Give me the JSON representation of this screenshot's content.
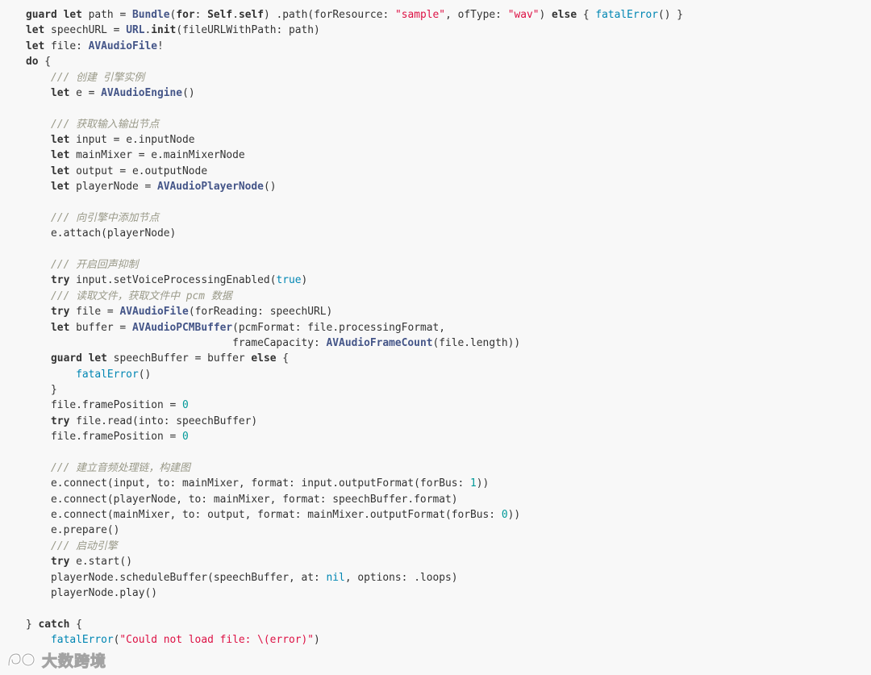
{
  "colors": {
    "background": "#f8f8f8",
    "plain": "#333333",
    "keyword": "#333333",
    "type": "#445588",
    "string": "#dd1144",
    "number": "#009999",
    "literal": "#0086b3",
    "comment": "#999988"
  },
  "code_lines": [
    [
      [
        "kw",
        "guard"
      ],
      [
        "pl",
        " "
      ],
      [
        "kw",
        "let"
      ],
      [
        "pl",
        " path = "
      ],
      [
        "ty",
        "Bundle"
      ],
      [
        "pl",
        "("
      ],
      [
        "kw",
        "for"
      ],
      [
        "pl",
        ": "
      ],
      [
        "kw",
        "Self"
      ],
      [
        "pl",
        "."
      ],
      [
        "kw",
        "self"
      ],
      [
        "pl",
        ") .path(forResource: "
      ],
      [
        "str",
        "\"sample\""
      ],
      [
        "pl",
        ", ofType: "
      ],
      [
        "str",
        "\"wav\""
      ],
      [
        "pl",
        ") "
      ],
      [
        "kw",
        "else"
      ],
      [
        "pl",
        " { "
      ],
      [
        "fn",
        "fatalError"
      ],
      [
        "pl",
        "() }"
      ]
    ],
    [
      [
        "kw",
        "let"
      ],
      [
        "pl",
        " speechURL = "
      ],
      [
        "ty",
        "URL"
      ],
      [
        "pl",
        "."
      ],
      [
        "kw",
        "init"
      ],
      [
        "pl",
        "(fileURLWithPath: path)"
      ]
    ],
    [
      [
        "kw",
        "let"
      ],
      [
        "pl",
        " file: "
      ],
      [
        "ty",
        "AVAudioFile"
      ],
      [
        "pl",
        "!"
      ]
    ],
    [
      [
        "kw",
        "do"
      ],
      [
        "pl",
        " {"
      ]
    ],
    [
      [
        "pl",
        "    "
      ],
      [
        "com",
        "/// 创建 引擎实例"
      ]
    ],
    [
      [
        "pl",
        "    "
      ],
      [
        "kw",
        "let"
      ],
      [
        "pl",
        " e = "
      ],
      [
        "ty",
        "AVAudioEngine"
      ],
      [
        "pl",
        "()"
      ]
    ],
    [
      [
        "pl",
        ""
      ]
    ],
    [
      [
        "pl",
        "    "
      ],
      [
        "com",
        "/// 获取输入输出节点"
      ]
    ],
    [
      [
        "pl",
        "    "
      ],
      [
        "kw",
        "let"
      ],
      [
        "pl",
        " input = e.inputNode"
      ]
    ],
    [
      [
        "pl",
        "    "
      ],
      [
        "kw",
        "let"
      ],
      [
        "pl",
        " mainMixer = e.mainMixerNode"
      ]
    ],
    [
      [
        "pl",
        "    "
      ],
      [
        "kw",
        "let"
      ],
      [
        "pl",
        " output = e.outputNode"
      ]
    ],
    [
      [
        "pl",
        "    "
      ],
      [
        "kw",
        "let"
      ],
      [
        "pl",
        " playerNode = "
      ],
      [
        "ty",
        "AVAudioPlayerNode"
      ],
      [
        "pl",
        "()"
      ]
    ],
    [
      [
        "pl",
        ""
      ]
    ],
    [
      [
        "pl",
        "    "
      ],
      [
        "com",
        "/// 向引擎中添加节点"
      ]
    ],
    [
      [
        "pl",
        "    e.attach(playerNode)"
      ]
    ],
    [
      [
        "pl",
        ""
      ]
    ],
    [
      [
        "pl",
        "    "
      ],
      [
        "com",
        "/// 开启回声抑制"
      ]
    ],
    [
      [
        "pl",
        "    "
      ],
      [
        "kw",
        "try"
      ],
      [
        "pl",
        " input.setVoiceProcessingEnabled("
      ],
      [
        "lit",
        "true"
      ],
      [
        "pl",
        ")"
      ]
    ],
    [
      [
        "pl",
        "    "
      ],
      [
        "com",
        "/// 读取文件，获取文件中 pcm 数据"
      ]
    ],
    [
      [
        "pl",
        "    "
      ],
      [
        "kw",
        "try"
      ],
      [
        "pl",
        " file = "
      ],
      [
        "ty",
        "AVAudioFile"
      ],
      [
        "pl",
        "(forReading: speechURL)"
      ]
    ],
    [
      [
        "pl",
        "    "
      ],
      [
        "kw",
        "let"
      ],
      [
        "pl",
        " buffer = "
      ],
      [
        "ty",
        "AVAudioPCMBuffer"
      ],
      [
        "pl",
        "(pcmFormat: file.processingFormat,"
      ]
    ],
    [
      [
        "pl",
        "                                 frameCapacity: "
      ],
      [
        "ty",
        "AVAudioFrameCount"
      ],
      [
        "pl",
        "(file.length))"
      ]
    ],
    [
      [
        "pl",
        "    "
      ],
      [
        "kw",
        "guard"
      ],
      [
        "pl",
        " "
      ],
      [
        "kw",
        "let"
      ],
      [
        "pl",
        " speechBuffer = buffer "
      ],
      [
        "kw",
        "else"
      ],
      [
        "pl",
        " {"
      ]
    ],
    [
      [
        "pl",
        "        "
      ],
      [
        "fn",
        "fatalError"
      ],
      [
        "pl",
        "()"
      ]
    ],
    [
      [
        "pl",
        "    }"
      ]
    ],
    [
      [
        "pl",
        "    file.framePosition = "
      ],
      [
        "num",
        "0"
      ]
    ],
    [
      [
        "pl",
        "    "
      ],
      [
        "kw",
        "try"
      ],
      [
        "pl",
        " file.read(into: speechBuffer)"
      ]
    ],
    [
      [
        "pl",
        "    file.framePosition = "
      ],
      [
        "num",
        "0"
      ]
    ],
    [
      [
        "pl",
        ""
      ]
    ],
    [
      [
        "pl",
        "    "
      ],
      [
        "com",
        "/// 建立音频处理链，构建图"
      ]
    ],
    [
      [
        "pl",
        "    e.connect(input, to: mainMixer, format: input.outputFormat(forBus: "
      ],
      [
        "num",
        "1"
      ],
      [
        "pl",
        "))"
      ]
    ],
    [
      [
        "pl",
        "    e.connect(playerNode, to: mainMixer, format: speechBuffer.format)"
      ]
    ],
    [
      [
        "pl",
        "    e.connect(mainMixer, to: output, format: mainMixer.outputFormat(forBus: "
      ],
      [
        "num",
        "0"
      ],
      [
        "pl",
        "))"
      ]
    ],
    [
      [
        "pl",
        "    e.prepare()"
      ]
    ],
    [
      [
        "pl",
        "    "
      ],
      [
        "com",
        "/// 启动引擎"
      ]
    ],
    [
      [
        "pl",
        "    "
      ],
      [
        "kw",
        "try"
      ],
      [
        "pl",
        " e.start()"
      ]
    ],
    [
      [
        "pl",
        "    playerNode.scheduleBuffer(speechBuffer, at: "
      ],
      [
        "lit",
        "nil"
      ],
      [
        "pl",
        ", options: .loops)"
      ]
    ],
    [
      [
        "pl",
        "    playerNode.play()"
      ]
    ],
    [
      [
        "pl",
        ""
      ]
    ],
    [
      [
        "pl",
        "} "
      ],
      [
        "kw",
        "catch"
      ],
      [
        "pl",
        " {"
      ]
    ],
    [
      [
        "pl",
        "    "
      ],
      [
        "fn",
        "fatalError"
      ],
      [
        "pl",
        "("
      ],
      [
        "str",
        "\"Could not load file: \\(error)\""
      ],
      [
        "pl",
        ")"
      ]
    ]
  ],
  "watermark": {
    "text": "大数跨境",
    "icon": "brand-logo-icon"
  }
}
